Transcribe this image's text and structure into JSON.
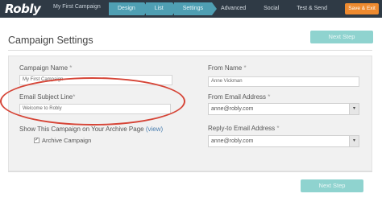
{
  "app": {
    "logo": "Robly",
    "campaign_name": "My First Campaign"
  },
  "nav": {
    "items": [
      {
        "label": "Design",
        "active": true
      },
      {
        "label": "List",
        "active": true
      },
      {
        "label": "Settings",
        "active": true
      },
      {
        "label": "Advanced",
        "active": false
      },
      {
        "label": "Social",
        "active": false
      },
      {
        "label": "Test & Send",
        "active": false
      }
    ],
    "save_exit": "Save & Exit"
  },
  "page": {
    "title": "Campaign Settings",
    "next_step": "Next Step"
  },
  "form": {
    "campaign_name": {
      "label": "Campaign Name",
      "value": "My First Campaign"
    },
    "subject_line": {
      "label": "Email Subject Line",
      "value": "Welcome to Robly"
    },
    "show_archive": {
      "label": "Show This Campaign on Your Archive Page",
      "link": "(view)"
    },
    "archive_checkbox": {
      "label": "Archive Campaign",
      "checked": true,
      "mark": "✓"
    },
    "from_name": {
      "label": "From Name",
      "value": "Anne Vickman"
    },
    "from_email": {
      "label": "From Email Address",
      "value": "anne@robly.com"
    },
    "reply_email": {
      "label": "Reply-to Email Address",
      "value": "anne@robly.com"
    },
    "required_mark": "*"
  },
  "colors": {
    "topbar": "#2f3a45",
    "active_tab": "#4f9fb3",
    "save_exit": "#ee8a2f",
    "next_button": "#8fd3cf",
    "highlight_ellipse": "#d64537"
  }
}
